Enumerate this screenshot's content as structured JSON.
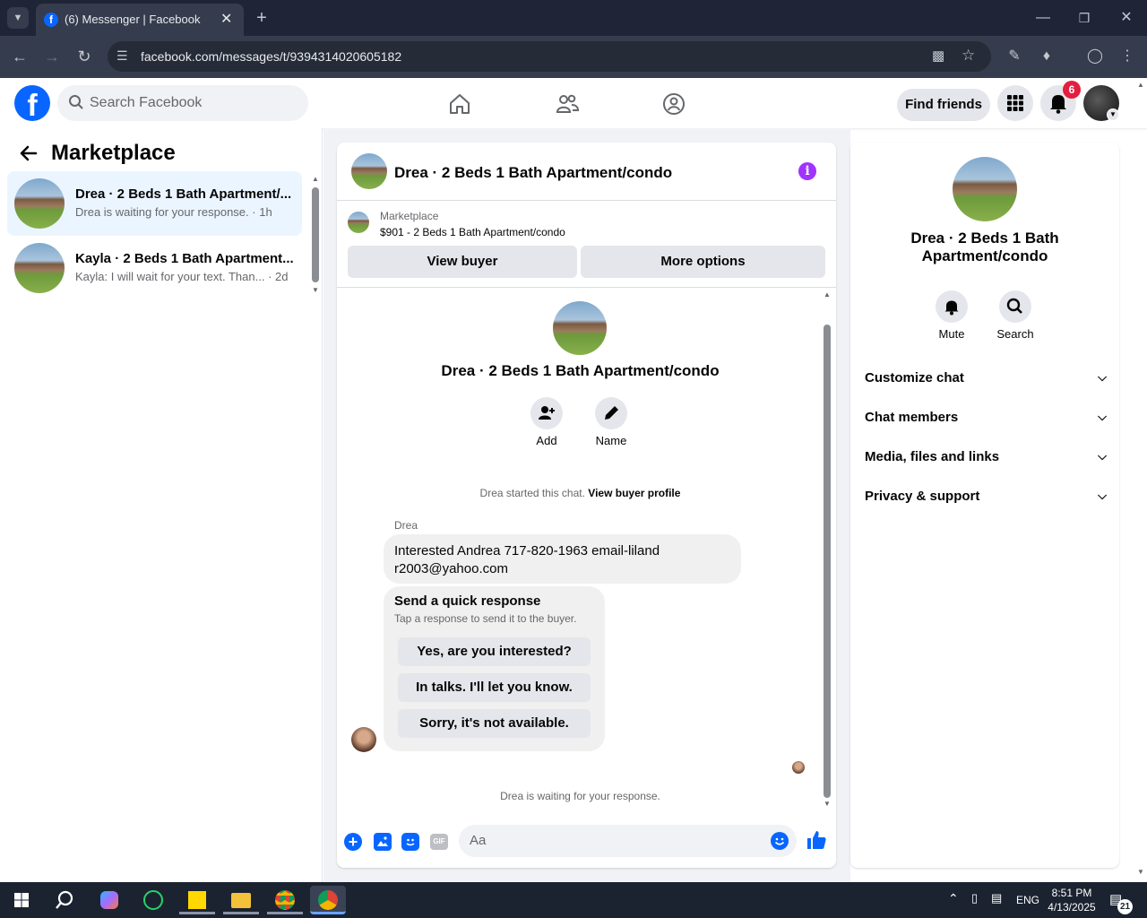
{
  "browser": {
    "tab_title": "(6) Messenger | Facebook",
    "url": "facebook.com/messages/t/9394314020605182"
  },
  "header": {
    "search_placeholder": "Search Facebook",
    "find_friends": "Find friends",
    "notification_count": "6"
  },
  "sidebar": {
    "title": "Marketplace",
    "conversations": [
      {
        "name": "Drea · 2 Beds 1 Bath Apartment/...",
        "preview": "Drea is waiting for your response.",
        "time": "· 1h"
      },
      {
        "name": "Kayla · 2 Beds 1 Bath Apartment...",
        "preview": "Kayla: I will wait for your text. Than...",
        "time": "· 2d"
      }
    ]
  },
  "chat": {
    "title": "Drea · 2 Beds 1 Bath Apartment/condo",
    "listing_label": "Marketplace",
    "listing_price": "$901 - 2 Beds 1 Bath Apartment/condo",
    "view_buyer": "View buyer",
    "more_options": "More options",
    "profile_name": "Drea · 2 Beds 1 Bath Apartment/condo",
    "add_label": "Add",
    "name_label": "Name",
    "started_text": "Drea started this chat.",
    "view_profile_link": "View buyer profile",
    "sender": "Drea",
    "message": "Interested Andrea 717-820-1963 email-lilandr2003@yahoo.com",
    "quick_title": "Send a quick response",
    "quick_subtitle": "Tap a response to send it to the buyer.",
    "quick_responses": [
      "Yes, are you interested?",
      "In talks. I'll let you know.",
      "Sorry, it's not available."
    ],
    "waiting_text": "Drea is waiting for your response.",
    "composer_placeholder": "Aa"
  },
  "details": {
    "name": "Drea · 2 Beds 1 Bath Apartment/condo",
    "mute": "Mute",
    "search": "Search",
    "sections": [
      "Customize chat",
      "Chat members",
      "Media, files and links",
      "Privacy & support"
    ]
  },
  "taskbar": {
    "lang": "ENG",
    "time": "8:51 PM",
    "date": "4/13/2025",
    "notif": "21"
  },
  "colors": {
    "fb_blue": "#0866ff",
    "messenger_purple": "#a033ff",
    "badge_red": "#e41e3f"
  }
}
